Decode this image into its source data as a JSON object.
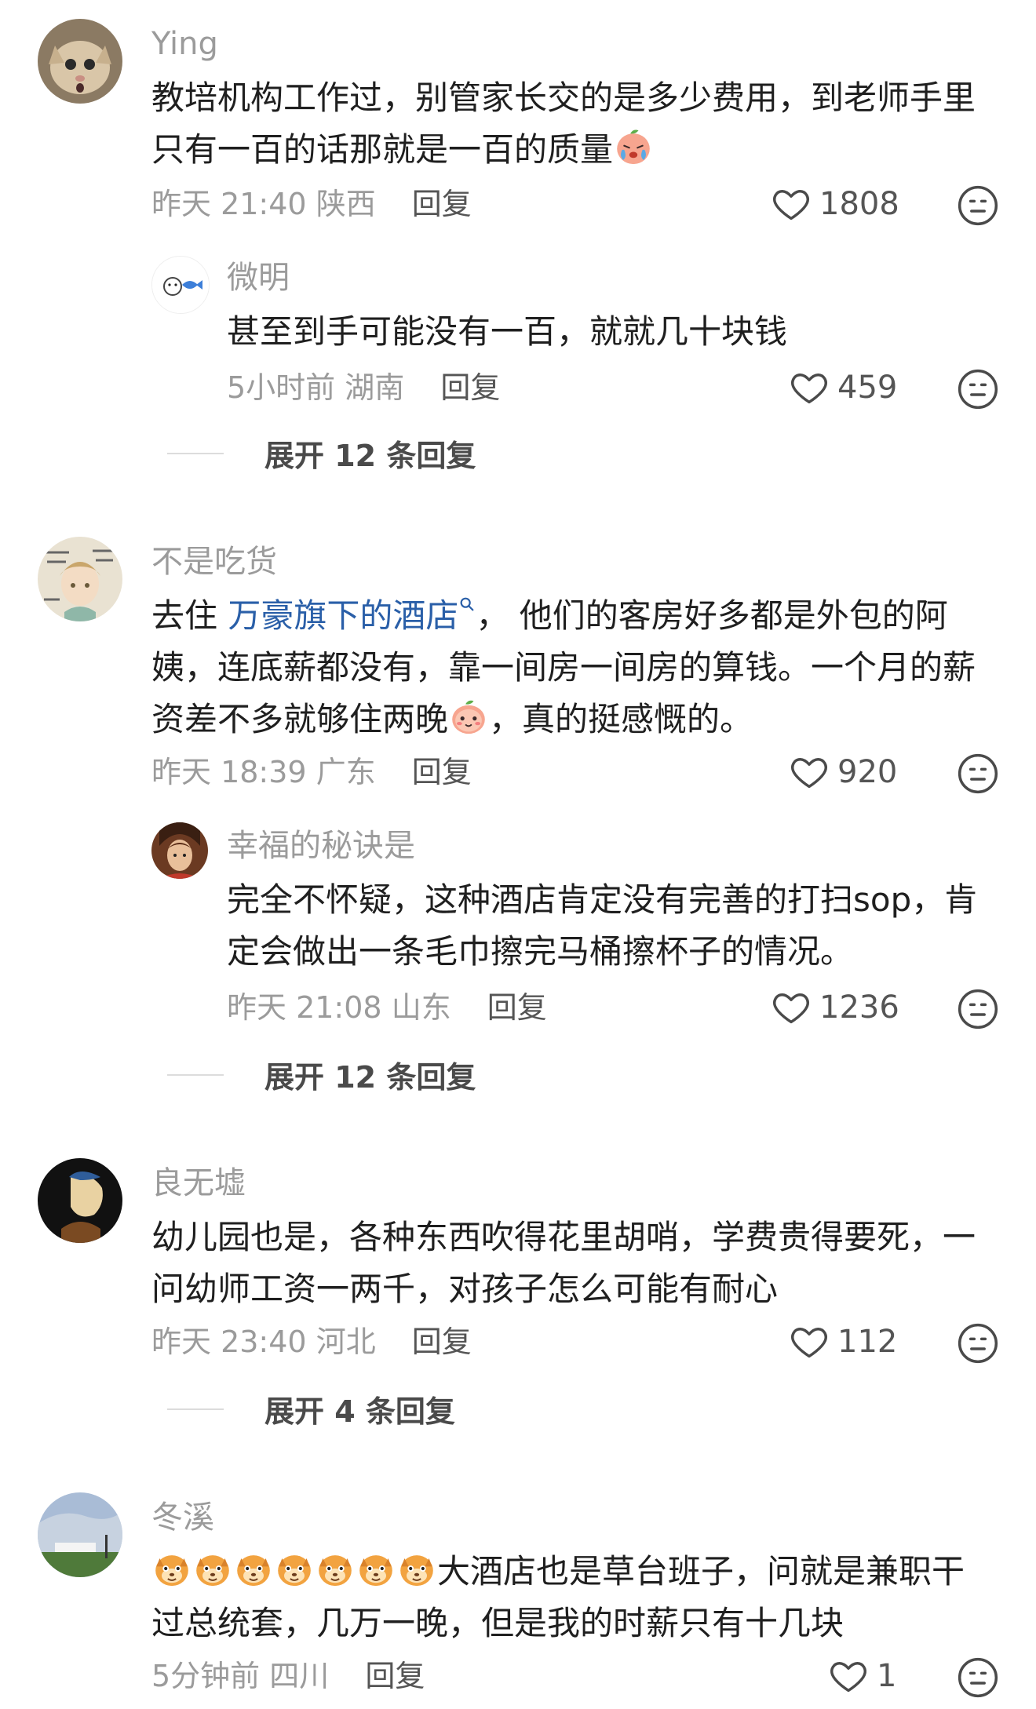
{
  "comments": [
    {
      "user": "Ying",
      "text": "教培机构工作过，别管家长交的是多少费用，到老师手里只有一百的话那就是一百的质量",
      "time": "昨天 21:40",
      "location": "陕西",
      "reply": "回复",
      "likes": "1808",
      "sub": {
        "user": "微明",
        "text": "甚至到手可能没有一百，就就几十块钱",
        "time": "5小时前",
        "location": "湖南",
        "reply": "回复",
        "likes": "459"
      },
      "expand": "展开 12 条回复"
    },
    {
      "user": "不是吃货",
      "text_pre": "去住 ",
      "link": "万豪旗下的酒店",
      "text_post": "， 他们的客房好多都是外包的阿姨，连底薪都没有，靠一间房一间房的算钱。一个月的薪资差不多就够住两晚",
      "text_end": "，真的挺感慨的。",
      "time": "昨天 18:39",
      "location": "广东",
      "reply": "回复",
      "likes": "920",
      "sub": {
        "user": "幸福的秘诀是",
        "text": "完全不怀疑，这种酒店肯定没有完善的打扫sop，肯定会做出一条毛巾擦完马桶擦杯子的情况。",
        "time": "昨天 21:08",
        "location": "山东",
        "reply": "回复",
        "likes": "1236"
      },
      "expand": "展开 12 条回复"
    },
    {
      "user": "良无墟",
      "text": "幼儿园也是，各种东西吹得花里胡哨，学费贵得要死，一问幼师工资一两千，对孩子怎么可能有耐心",
      "time": "昨天 23:40",
      "location": "河北",
      "reply": "回复",
      "likes": "112",
      "expand": "展开 4 条回复"
    },
    {
      "user": "冬溪",
      "text": "大酒店也是草台班子，问就是兼职干过总统套，几万一晚，但是我的时薪只有十几块",
      "time": "5分钟前",
      "location": "四川",
      "reply": "回复",
      "likes": "1"
    }
  ],
  "colors": {
    "link": "#2a5fa8",
    "meta": "#9b9b9b",
    "text": "#1f1f1f"
  },
  "icons": [
    "heart-icon",
    "neutral-face-icon",
    "search-link-icon",
    "emoji-cry",
    "emoji-peach"
  ]
}
